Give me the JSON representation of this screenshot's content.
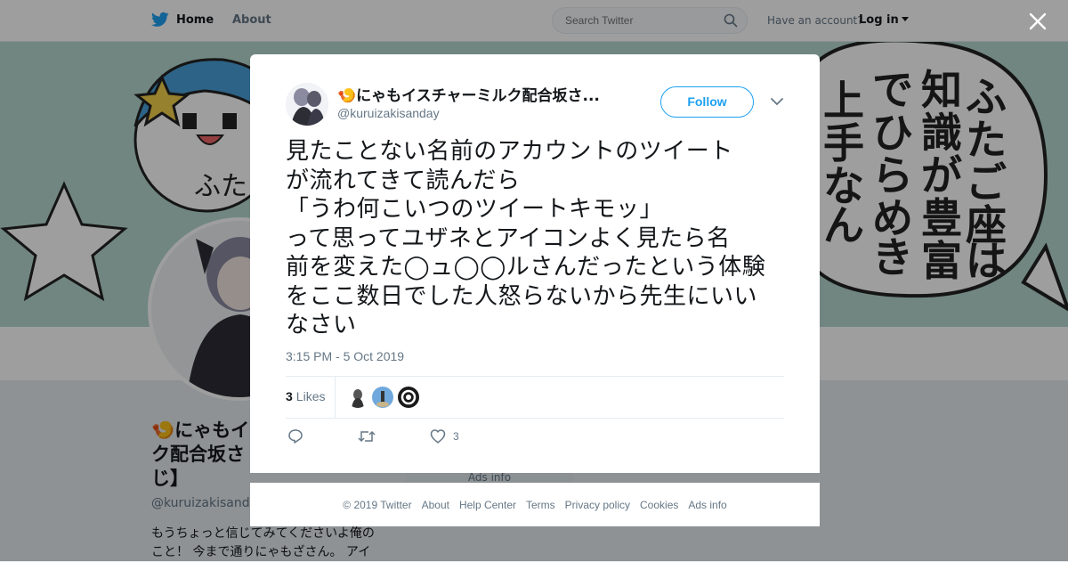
{
  "nav": {
    "home_label": "Home",
    "about_label": "About",
    "search_placeholder": "Search Twitter",
    "account_prompt": "Have an account?",
    "login_label": "Log in"
  },
  "background_profile": {
    "name": "🍤にゃもイスチャーミルク配合坂さんじ】",
    "name_line1": "🍤にゃもイ",
    "name_line2": "ク配合坂さ",
    "name_line3": "じ】",
    "handle": "@kuruizakisanday",
    "bio_line1": "もうちょっと信じてみてくださいよ俺の",
    "bio_line2": "こと！ 今まで通りにゃもざさん。 アイ",
    "ads_label": "Ads info"
  },
  "banner": {
    "text_columns": [
      "ふたご座は",
      "知識が豊富",
      "でひらめき",
      "上手なん"
    ],
    "left_text": "ふた"
  },
  "tweet": {
    "author_name": "🍤にゃもイスチャーミルク配合坂さ...",
    "author_handle": "@kuruizakisanday",
    "follow_label": "Follow",
    "text": "見たことない名前のアカウントのツイート\nが流れてきて読んだら\n「うわ何こいつのツイートキモッ」\nって思ってユザネとアイコンよく見たら名\n前を変えた◯ュ◯◯ルさんだったという体験\nをここ数日でした人怒らないから先生にいい\nなさい",
    "timestamp": "3:15 PM - 5 Oct 2019",
    "likes_count": "3",
    "likes_label": "Likes",
    "like_action_count": "3"
  },
  "footer": {
    "links": [
      "© 2019 Twitter",
      "About",
      "Help Center",
      "Terms",
      "Privacy policy",
      "Cookies",
      "Ads info"
    ]
  },
  "colors": {
    "twitter_blue": "#1da1f2",
    "text_primary": "#14171a",
    "text_secondary": "#657786",
    "banner_bg": "#b6d9d1"
  }
}
